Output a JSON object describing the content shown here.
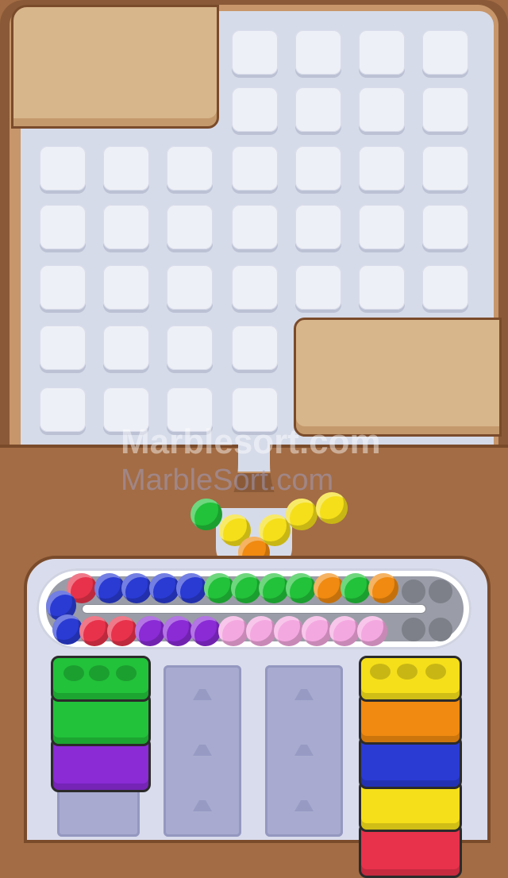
{
  "watermark": {
    "primary": "Marblesort.com",
    "secondary": "MarbleSort.com"
  },
  "colors": {
    "red": "#e8324b",
    "blue": "#2a3bd4",
    "green": "#22c23a",
    "orange": "#f08a10",
    "yellow": "#f5df1a",
    "purple": "#8a2bd6",
    "pink": "#f4a8e0"
  },
  "falling_marbles": [
    "green",
    "yellow",
    "orange",
    "yellow",
    "yellow",
    "yellow"
  ],
  "track_top_row": [
    "red",
    "blue",
    "blue",
    "blue",
    "blue",
    "green",
    "green",
    "green",
    "green",
    "orange",
    "green",
    "orange"
  ],
  "track_left_turn": [
    "blue",
    "blue"
  ],
  "track_bottom_row": [
    "red",
    "red",
    "purple",
    "purple",
    "purple",
    "pink",
    "pink",
    "pink",
    "pink",
    "pink",
    "pink"
  ],
  "left_stack": [
    "green",
    "green",
    "purple"
  ],
  "right_stack": [
    "yellow",
    "orange",
    "blue",
    "yellow",
    "red"
  ]
}
